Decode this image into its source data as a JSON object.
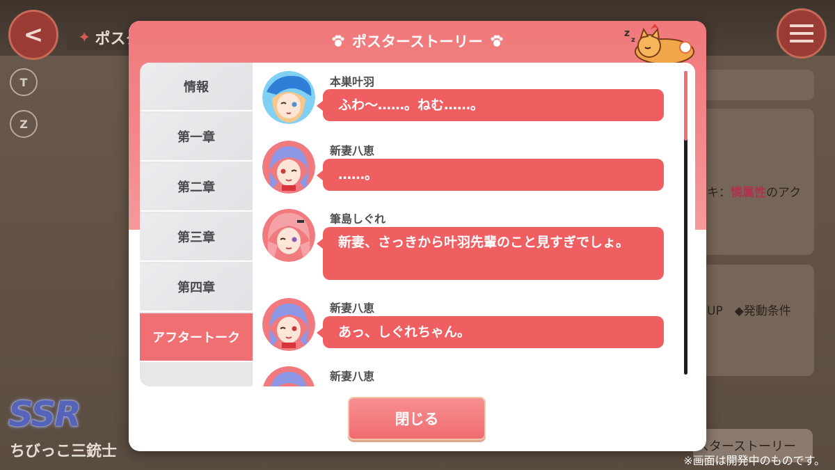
{
  "background": {
    "screen_title": "ポスタ",
    "panel_text_1_prefix": "キ：",
    "panel_text_1_highlight": "憐属性",
    "panel_text_1_suffix": "のアク",
    "panel_text_2": "UP　◆発動条件",
    "rarity": "SSR",
    "card_name": "ちびっこ三銃士",
    "bottom_button": "スターストーリー",
    "notice": "※画面は開発中のものです。"
  },
  "modal": {
    "title": "ポスターストーリー",
    "tabs": [
      {
        "label": "情報",
        "active": false
      },
      {
        "label": "第一章",
        "active": false
      },
      {
        "label": "第二章",
        "active": false
      },
      {
        "label": "第三章",
        "active": false
      },
      {
        "label": "第四章",
        "active": false
      },
      {
        "label": "アフタートーク",
        "active": true
      }
    ],
    "messages": [
      {
        "speaker": "本巣叶羽",
        "text": "ふわ〜……。ねむ……。",
        "avatar": "kanau-avatar"
      },
      {
        "speaker": "新妻八恵",
        "text": "……。",
        "avatar": "yae-avatar"
      },
      {
        "speaker": "筆島しぐれ",
        "text": "新妻、さっきから叶羽先輩のこと見すぎでしょ。",
        "avatar": "shigure-avatar"
      },
      {
        "speaker": "新妻八恵",
        "text": "あっ、しぐれちゃん。",
        "avatar": "yae-avatar"
      },
      {
        "speaker": "新妻八恵",
        "text": "",
        "avatar": "yae-avatar"
      }
    ],
    "close_label": "閉じる"
  },
  "colors": {
    "accent": "#ef5f62",
    "header": "#f0787a",
    "tab_active": "#f06f73",
    "tab_inactive": "#e7e7ea"
  }
}
